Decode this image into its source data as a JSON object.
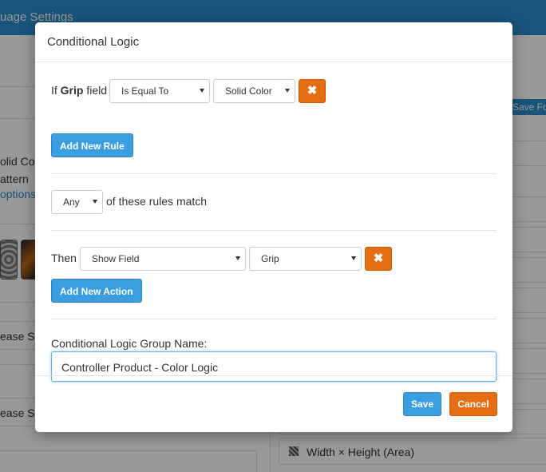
{
  "background": {
    "header_title": "uage Settings",
    "left_texts": [
      "olid Col",
      "attern",
      "options",
      "ease S",
      "ease S"
    ],
    "save_button": "Save Fo",
    "area_row_label": "Width × Height (Area)"
  },
  "modal": {
    "title": "Conditional Logic",
    "rule": {
      "prefix": "If",
      "field_name": "Grip",
      "suffix": "field",
      "operator": "Is Equal To",
      "value": "Solid Color",
      "remove_icon": "✖",
      "add_rule_label": "Add New Rule"
    },
    "match": {
      "mode": "Any",
      "text": "of these rules match"
    },
    "action": {
      "prefix": "Then",
      "action_type": "Show Field",
      "target_field": "Grip",
      "remove_icon": "✖",
      "add_action_label": "Add New Action"
    },
    "group_name": {
      "label": "Conditional Logic Group Name:",
      "value": "Controller Product - Color Logic"
    },
    "footer": {
      "save_label": "Save",
      "cancel_label": "Cancel"
    }
  },
  "colors": {
    "primary": "#3a9ee0",
    "danger": "#e56d12",
    "header": "#2b8ccb"
  }
}
